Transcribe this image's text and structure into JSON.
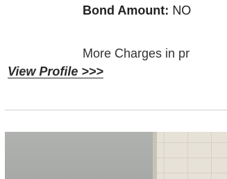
{
  "bond": {
    "label": "Bond Amount:",
    "value": "NO"
  },
  "charges": {
    "text": "More Charges in pr"
  },
  "profile_link": {
    "label": "View Profile >>>"
  }
}
